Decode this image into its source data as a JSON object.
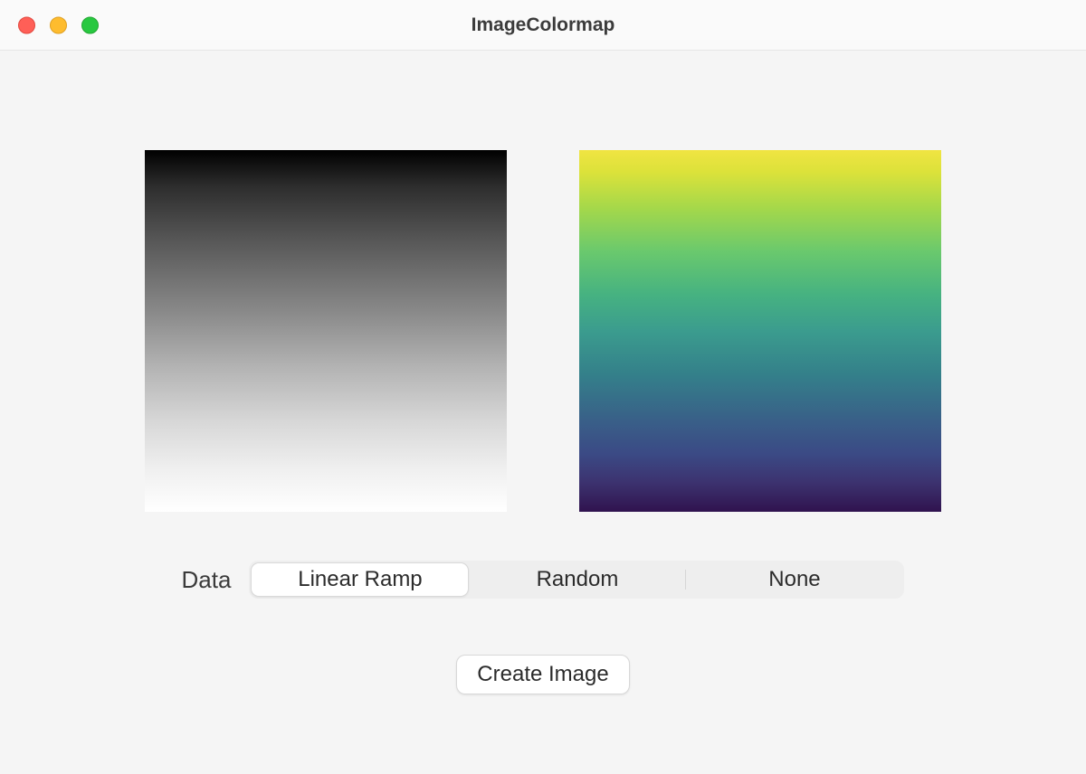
{
  "window": {
    "title": "ImageColormap"
  },
  "previews": {
    "left_type": "grayscale-linear-ramp",
    "right_type": "viridis-linear-ramp"
  },
  "controls": {
    "data_label": "Data",
    "segments": {
      "linear_ramp": "Linear Ramp",
      "random": "Random",
      "none": "None",
      "selected": "linear_ramp"
    },
    "create_button": "Create Image"
  }
}
